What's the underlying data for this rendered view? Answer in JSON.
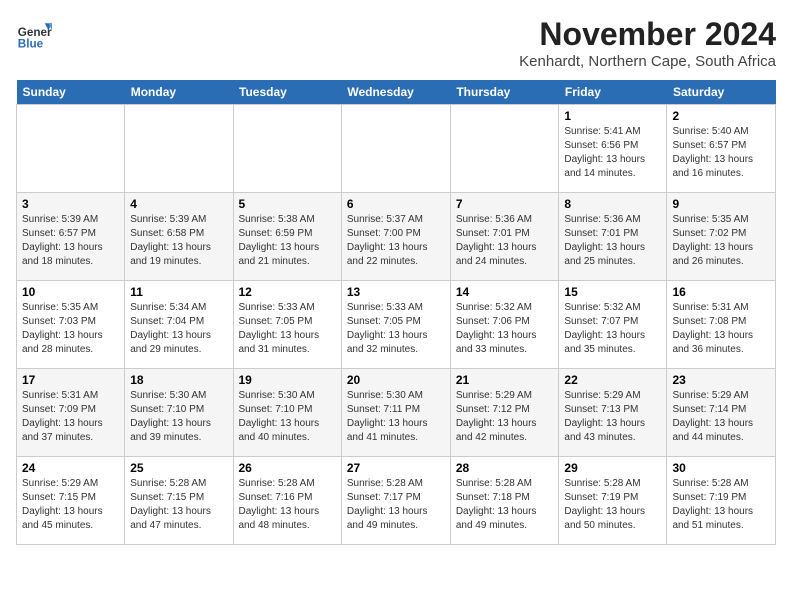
{
  "logo": {
    "general": "General",
    "blue": "Blue"
  },
  "title": "November 2024",
  "location": "Kenhardt, Northern Cape, South Africa",
  "days_of_week": [
    "Sunday",
    "Monday",
    "Tuesday",
    "Wednesday",
    "Thursday",
    "Friday",
    "Saturday"
  ],
  "weeks": [
    [
      {
        "day": "",
        "info": ""
      },
      {
        "day": "",
        "info": ""
      },
      {
        "day": "",
        "info": ""
      },
      {
        "day": "",
        "info": ""
      },
      {
        "day": "",
        "info": ""
      },
      {
        "day": "1",
        "info": "Sunrise: 5:41 AM\nSunset: 6:56 PM\nDaylight: 13 hours\nand 14 minutes."
      },
      {
        "day": "2",
        "info": "Sunrise: 5:40 AM\nSunset: 6:57 PM\nDaylight: 13 hours\nand 16 minutes."
      }
    ],
    [
      {
        "day": "3",
        "info": "Sunrise: 5:39 AM\nSunset: 6:57 PM\nDaylight: 13 hours\nand 18 minutes."
      },
      {
        "day": "4",
        "info": "Sunrise: 5:39 AM\nSunset: 6:58 PM\nDaylight: 13 hours\nand 19 minutes."
      },
      {
        "day": "5",
        "info": "Sunrise: 5:38 AM\nSunset: 6:59 PM\nDaylight: 13 hours\nand 21 minutes."
      },
      {
        "day": "6",
        "info": "Sunrise: 5:37 AM\nSunset: 7:00 PM\nDaylight: 13 hours\nand 22 minutes."
      },
      {
        "day": "7",
        "info": "Sunrise: 5:36 AM\nSunset: 7:01 PM\nDaylight: 13 hours\nand 24 minutes."
      },
      {
        "day": "8",
        "info": "Sunrise: 5:36 AM\nSunset: 7:01 PM\nDaylight: 13 hours\nand 25 minutes."
      },
      {
        "day": "9",
        "info": "Sunrise: 5:35 AM\nSunset: 7:02 PM\nDaylight: 13 hours\nand 26 minutes."
      }
    ],
    [
      {
        "day": "10",
        "info": "Sunrise: 5:35 AM\nSunset: 7:03 PM\nDaylight: 13 hours\nand 28 minutes."
      },
      {
        "day": "11",
        "info": "Sunrise: 5:34 AM\nSunset: 7:04 PM\nDaylight: 13 hours\nand 29 minutes."
      },
      {
        "day": "12",
        "info": "Sunrise: 5:33 AM\nSunset: 7:05 PM\nDaylight: 13 hours\nand 31 minutes."
      },
      {
        "day": "13",
        "info": "Sunrise: 5:33 AM\nSunset: 7:05 PM\nDaylight: 13 hours\nand 32 minutes."
      },
      {
        "day": "14",
        "info": "Sunrise: 5:32 AM\nSunset: 7:06 PM\nDaylight: 13 hours\nand 33 minutes."
      },
      {
        "day": "15",
        "info": "Sunrise: 5:32 AM\nSunset: 7:07 PM\nDaylight: 13 hours\nand 35 minutes."
      },
      {
        "day": "16",
        "info": "Sunrise: 5:31 AM\nSunset: 7:08 PM\nDaylight: 13 hours\nand 36 minutes."
      }
    ],
    [
      {
        "day": "17",
        "info": "Sunrise: 5:31 AM\nSunset: 7:09 PM\nDaylight: 13 hours\nand 37 minutes."
      },
      {
        "day": "18",
        "info": "Sunrise: 5:30 AM\nSunset: 7:10 PM\nDaylight: 13 hours\nand 39 minutes."
      },
      {
        "day": "19",
        "info": "Sunrise: 5:30 AM\nSunset: 7:10 PM\nDaylight: 13 hours\nand 40 minutes."
      },
      {
        "day": "20",
        "info": "Sunrise: 5:30 AM\nSunset: 7:11 PM\nDaylight: 13 hours\nand 41 minutes."
      },
      {
        "day": "21",
        "info": "Sunrise: 5:29 AM\nSunset: 7:12 PM\nDaylight: 13 hours\nand 42 minutes."
      },
      {
        "day": "22",
        "info": "Sunrise: 5:29 AM\nSunset: 7:13 PM\nDaylight: 13 hours\nand 43 minutes."
      },
      {
        "day": "23",
        "info": "Sunrise: 5:29 AM\nSunset: 7:14 PM\nDaylight: 13 hours\nand 44 minutes."
      }
    ],
    [
      {
        "day": "24",
        "info": "Sunrise: 5:29 AM\nSunset: 7:15 PM\nDaylight: 13 hours\nand 45 minutes."
      },
      {
        "day": "25",
        "info": "Sunrise: 5:28 AM\nSunset: 7:15 PM\nDaylight: 13 hours\nand 47 minutes."
      },
      {
        "day": "26",
        "info": "Sunrise: 5:28 AM\nSunset: 7:16 PM\nDaylight: 13 hours\nand 48 minutes."
      },
      {
        "day": "27",
        "info": "Sunrise: 5:28 AM\nSunset: 7:17 PM\nDaylight: 13 hours\nand 49 minutes."
      },
      {
        "day": "28",
        "info": "Sunrise: 5:28 AM\nSunset: 7:18 PM\nDaylight: 13 hours\nand 49 minutes."
      },
      {
        "day": "29",
        "info": "Sunrise: 5:28 AM\nSunset: 7:19 PM\nDaylight: 13 hours\nand 50 minutes."
      },
      {
        "day": "30",
        "info": "Sunrise: 5:28 AM\nSunset: 7:19 PM\nDaylight: 13 hours\nand 51 minutes."
      }
    ]
  ]
}
